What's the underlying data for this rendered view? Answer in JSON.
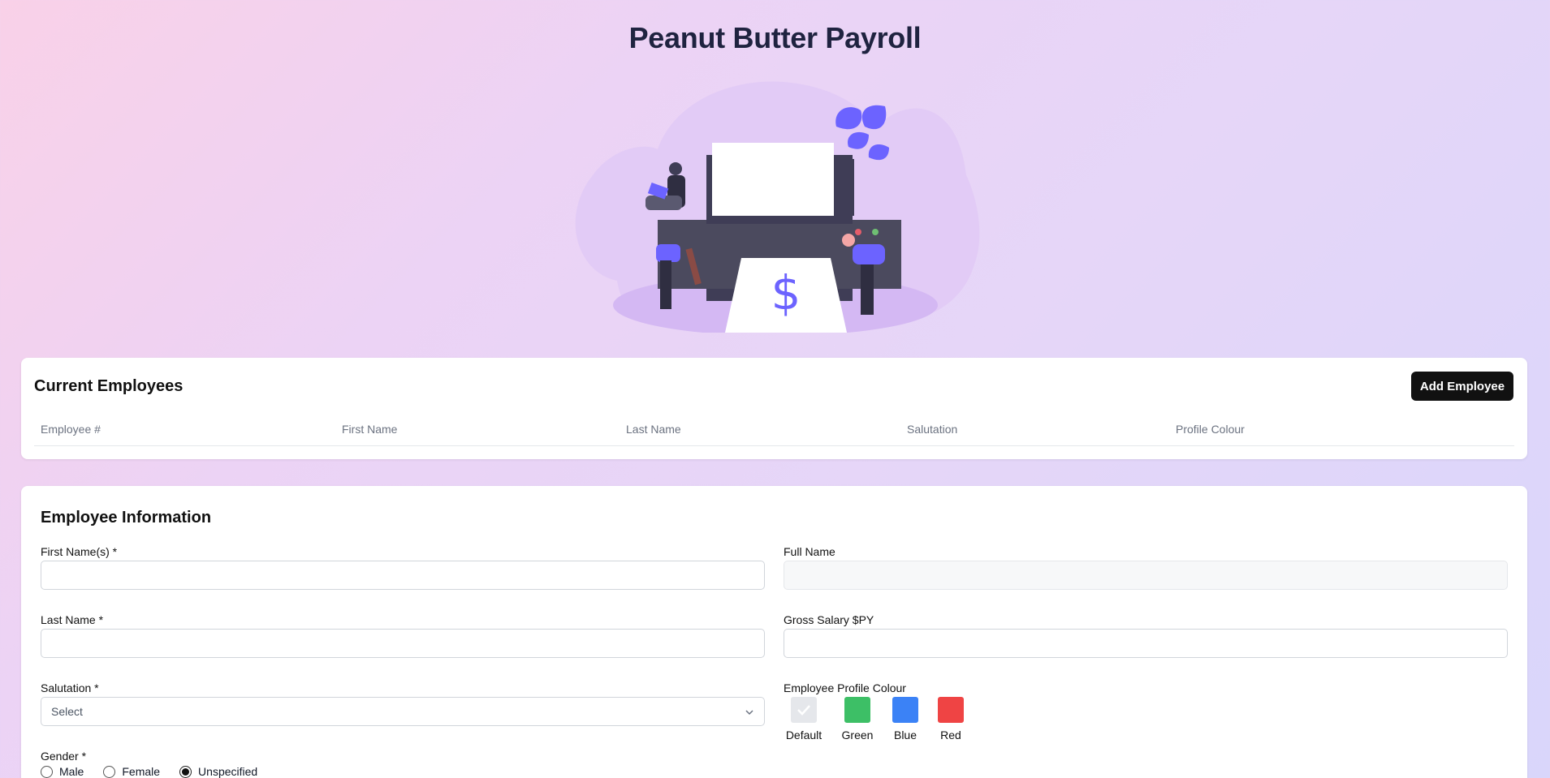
{
  "app": {
    "title": "Peanut Butter Payroll"
  },
  "employees": {
    "heading": "Current Employees",
    "add_button": "Add Employee",
    "columns": [
      "Employee #",
      "First Name",
      "Last Name",
      "Salutation",
      "Profile Colour"
    ],
    "rows": []
  },
  "form": {
    "heading": "Employee Information",
    "first_name": {
      "label": "First Name(s) *",
      "value": ""
    },
    "last_name": {
      "label": "Last Name *",
      "value": ""
    },
    "salutation": {
      "label": "Salutation *",
      "value": "Select"
    },
    "gender": {
      "label": "Gender *",
      "options": [
        "Male",
        "Female",
        "Unspecified"
      ],
      "selected": "Unspecified"
    },
    "full_name": {
      "label": "Full Name",
      "value": ""
    },
    "gross_salary": {
      "label": "Gross Salary $PY",
      "value": ""
    },
    "profile_colour": {
      "label": "Employee Profile Colour",
      "options": [
        {
          "name": "Default",
          "color": "#e5e7eb",
          "selected": true
        },
        {
          "name": "Green",
          "color": "#3dbf66",
          "selected": false
        },
        {
          "name": "Blue",
          "color": "#3b82f6",
          "selected": false
        },
        {
          "name": "Red",
          "color": "#ef4444",
          "selected": false
        }
      ]
    }
  },
  "colors": {
    "accent": "#6c63ff",
    "button_bg": "#111111"
  }
}
